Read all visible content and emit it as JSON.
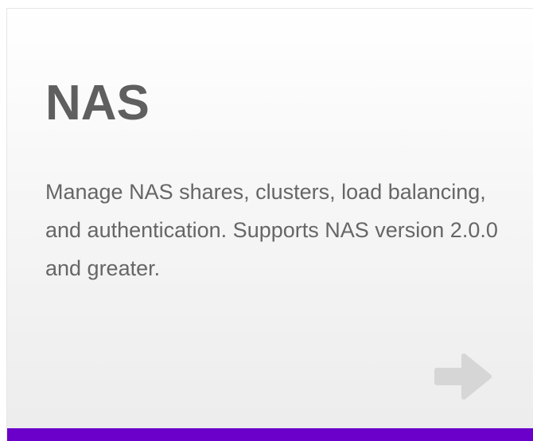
{
  "card": {
    "title": "NAS",
    "description": "Manage NAS shares, clusters, load balancing, and authentication. Supports NAS version 2.0.0 and greater.",
    "arrow_icon": "arrow-right-icon",
    "accent_color": "#6a00c9",
    "arrow_color": "#d6d6d6"
  }
}
